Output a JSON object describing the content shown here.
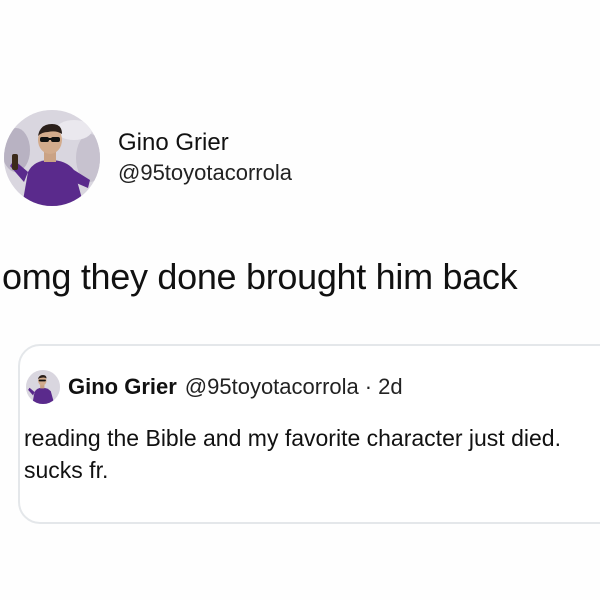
{
  "tweet": {
    "author": {
      "display_name": "Gino Grier",
      "handle": "@95toyotacorrola",
      "avatar_icon": "profile-photo-icon"
    },
    "text": "omg they done brought him back",
    "quoted_tweet": {
      "author": {
        "display_name": "Gino Grier",
        "handle": "@95toyotacorrola",
        "avatar_icon": "profile-photo-icon"
      },
      "separator": "·",
      "time": "2d",
      "text": "reading the Bible and my favorite character just died. sucks fr."
    }
  },
  "colors": {
    "background": "#ffffff",
    "text": "#111111",
    "card_border": "#e4e7ea",
    "avatar_shirt": "#5a2a8c"
  }
}
